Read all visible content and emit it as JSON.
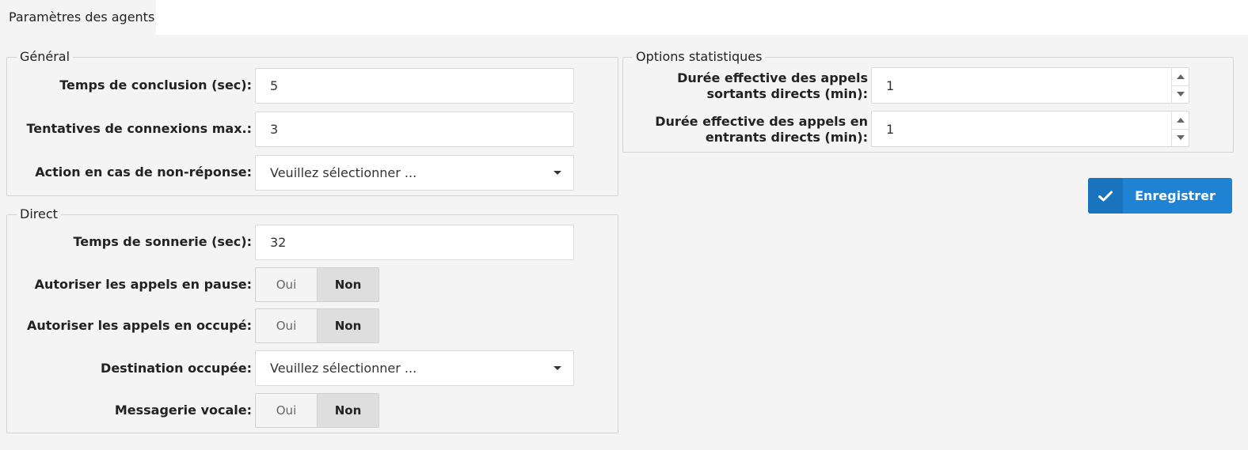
{
  "tabs": [
    {
      "label": "Paramètres des agents"
    }
  ],
  "general": {
    "legend": "Général",
    "wrapup_label": "Temps de conclusion (sec):",
    "wrapup_value": "5",
    "max_attempts_label": "Tentatives de connexions max.:",
    "max_attempts_value": "3",
    "no_answer_label": "Action en cas de non-réponse:",
    "no_answer_value": "Veuillez sélectionner ..."
  },
  "direct": {
    "legend": "Direct",
    "ring_time_label": "Temps de sonnerie (sec):",
    "ring_time_value": "32",
    "allow_paused_label": "Autoriser les appels en pause:",
    "allow_busy_label": "Autoriser les appels en occupé:",
    "busy_dest_label": "Destination occupée:",
    "busy_dest_value": "Veuillez sélectionner ...",
    "voicemail_label": "Messagerie vocale:",
    "toggle_yes": "Oui",
    "toggle_no": "Non",
    "allow_paused_selected": "Non",
    "allow_busy_selected": "Non",
    "voicemail_selected": "Non"
  },
  "stats": {
    "legend": "Options statistiques",
    "outgoing_label": "Durée effective des appels sortants directs (min):",
    "outgoing_value": "1",
    "incoming_label": "Durée effective des appels en entrants directs (min):",
    "incoming_value": "1"
  },
  "actions": {
    "save_label": "Enregistrer"
  },
  "icons": {
    "save": "check-icon",
    "dropdown": "caret-down-icon",
    "spin_up": "spin-up-icon",
    "spin_down": "spin-down-icon"
  },
  "colors": {
    "accent": "#1f82d2",
    "background": "#f4f4f4",
    "toggle_selected": "#dedede"
  }
}
